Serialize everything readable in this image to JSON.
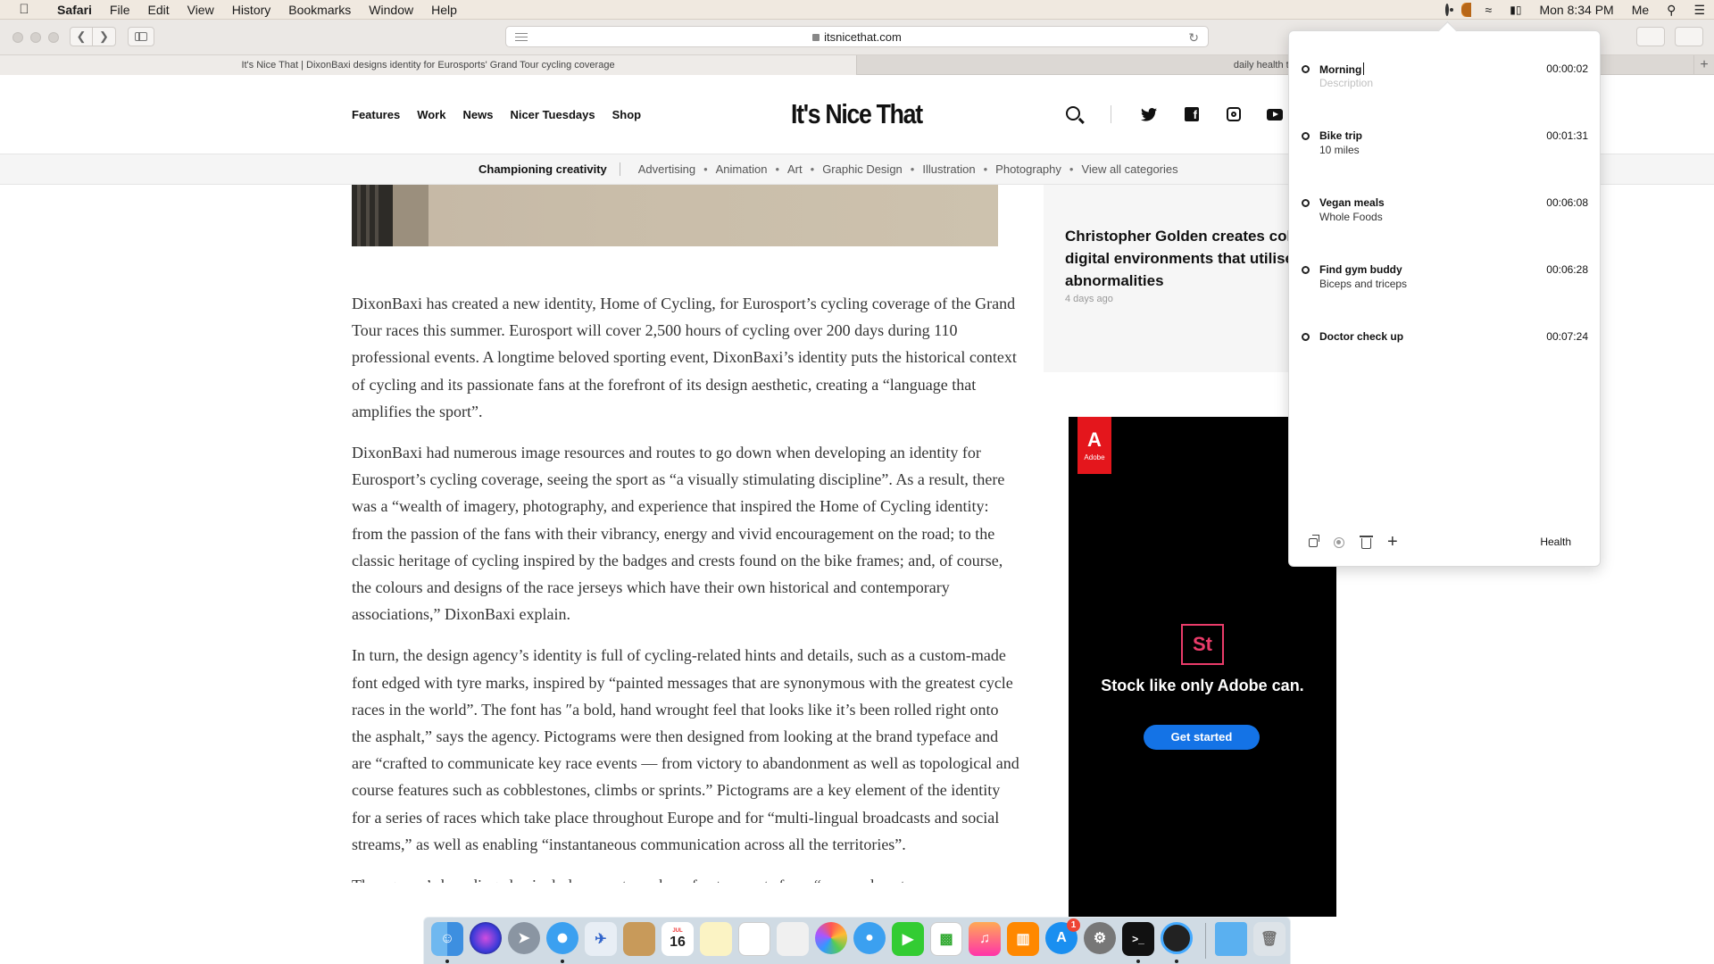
{
  "menubar": {
    "app": "Safari",
    "items": [
      "File",
      "Edit",
      "View",
      "History",
      "Bookmarks",
      "Window",
      "Help"
    ],
    "clock": "Mon 8:34 PM",
    "user": "Me"
  },
  "browser": {
    "url": "itsnicethat.com",
    "tabs": [
      {
        "title": "It's Nice That | DixonBaxi designs identity for Eurosports' Grand Tour cycling coverage",
        "active": true
      },
      {
        "title": "daily health tips - G",
        "active": false
      }
    ]
  },
  "site": {
    "logo": "It's Nice That",
    "nav": [
      "Features",
      "Work",
      "News",
      "Nicer Tuesdays",
      "Shop"
    ],
    "social_icons": [
      "twitter-icon",
      "facebook-icon",
      "instagram-icon",
      "youtube-icon"
    ],
    "category_title": "Championing creativity",
    "categories": [
      "Advertising",
      "Animation",
      "Art",
      "Graphic Design",
      "Illustration",
      "Photography",
      "View all categories"
    ]
  },
  "article": {
    "paragraphs": [
      "DixonBaxi has created a new identity, Home of Cycling, for Eurosport’s cycling coverage of the Grand Tour races this summer. Eurosport will cover 2,500 hours of cycling over 200 days during 110 professional events. A longtime beloved sporting event, DixonBaxi’s identity puts the historical context of cycling and its passionate fans at the forefront of its design aesthetic, creating a “language that amplifies the sport”.",
      "DixonBaxi had numerous image resources and routes to go down when developing an identity for Eurosport’s cycling coverage, seeing the sport as “a visually stimulating discipline”. As a result, there was a “wealth of imagery, photography, and experience that inspired the Home of Cycling identity: from the passion of the fans with their vibrancy, energy and vivid encouragement on the road; to the classic heritage of cycling inspired by the badges and crests found on the bike frames; and, of course, the colours and designs of the race jerseys which have their own historical and contemporary associations,” DixonBaxi explain.",
      "In turn, the design agency’s identity is full of cycling-related hints and details, such as a custom-made font edged with tyre marks, inspired by “painted messages that are synonymous with the greatest cycle races in the world”. The font has ″a bold, hand wrought feel that looks like it’s been rolled right onto the asphalt,” says the agency. Pictograms were then designed from looking at the brand typeface and are “crafted to communicate key race events — from victory to abandonment as well as topological and course features such as cobblestones, climbs or sprints.” Pictograms are a key element of the identity for a series of races which take place throughout Europe and for “multi-lingual broadcasts and social streams,” as well as enabling “instantaneous communication across all the territories”.",
      "The agency’s branding also includes a vast number of extra assets from “pre- and post- race"
    ]
  },
  "sidebar": {
    "story_title": "Christopher Golden creates colourful digital environments that utilise visual abnormalities",
    "story_age": "4 days ago"
  },
  "ad": {
    "brand": "Adobe",
    "product_badge": "St",
    "headline": "Stock like only Adobe can.",
    "cta": "Get started"
  },
  "timer": {
    "entries": [
      {
        "title": "Morning",
        "description": "",
        "placeholder": "Description",
        "time": "00:00:02",
        "editing": true
      },
      {
        "title": "Bike trip",
        "description": "10 miles",
        "time": "00:01:31"
      },
      {
        "title": "Vegan meals",
        "description": "Whole Foods",
        "time": "00:06:08"
      },
      {
        "title": "Find gym buddy",
        "description": "Biceps and triceps",
        "time": "00:06:28"
      },
      {
        "title": "Doctor check up",
        "description": "",
        "time": "00:07:24"
      }
    ],
    "project": "Health"
  },
  "dock": {
    "calendar_month": "JUL",
    "calendar_day": "16",
    "appstore_badge": "1"
  }
}
